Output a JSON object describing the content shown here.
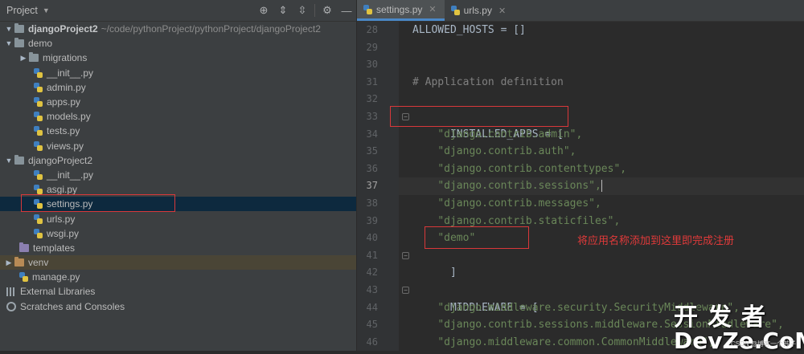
{
  "sidebar": {
    "title": "Project",
    "root": {
      "name": "djangoProject2",
      "path": "~/code/pythonProject/pythonProject/djangoProject2"
    },
    "items": [
      {
        "label": "demo"
      },
      {
        "label": "migrations"
      },
      {
        "label": "__init__.py"
      },
      {
        "label": "admin.py"
      },
      {
        "label": "apps.py"
      },
      {
        "label": "models.py"
      },
      {
        "label": "tests.py"
      },
      {
        "label": "views.py"
      },
      {
        "label": "djangoProject2"
      },
      {
        "label": "__init__.py"
      },
      {
        "label": "asgi.py"
      },
      {
        "label": "settings.py"
      },
      {
        "label": "urls.py"
      },
      {
        "label": "wsgi.py"
      },
      {
        "label": "templates"
      },
      {
        "label": "venv"
      },
      {
        "label": "manage.py"
      },
      {
        "label": "External Libraries"
      },
      {
        "label": "Scratches and Consoles"
      }
    ]
  },
  "tabs": [
    {
      "label": "settings.py",
      "active": true
    },
    {
      "label": "urls.py",
      "active": false
    }
  ],
  "editor": {
    "current_line": 37,
    "lines": [
      {
        "num": "28",
        "text": "ALLOWED_HOSTS = []"
      },
      {
        "num": "29",
        "text": ""
      },
      {
        "num": "30",
        "text": ""
      },
      {
        "num": "31",
        "text": "# Application definition"
      },
      {
        "num": "32",
        "text": ""
      },
      {
        "num": "33",
        "text": "INSTALLED_APPS = ["
      },
      {
        "num": "34",
        "text": "\"django.contrib.admin\","
      },
      {
        "num": "35",
        "text": "\"django.contrib.auth\","
      },
      {
        "num": "36",
        "text": "\"django.contrib.contenttypes\","
      },
      {
        "num": "37",
        "text": "\"django.contrib.sessions\","
      },
      {
        "num": "38",
        "text": "\"django.contrib.messages\","
      },
      {
        "num": "39",
        "text": "\"django.contrib.staticfiles\","
      },
      {
        "num": "40",
        "text": "\"demo\""
      },
      {
        "num": "41",
        "text": "]"
      },
      {
        "num": "42",
        "text": ""
      },
      {
        "num": "43",
        "text": "MIDDLEWARE = ["
      },
      {
        "num": "44",
        "text": "\"django.middleware.security.SecurityMiddleware\","
      },
      {
        "num": "45",
        "text": "\"django.contrib.sessions.middleware.SessionMiddleware\","
      },
      {
        "num": "46",
        "text": "\"django.middleware.common.CommonMiddleware\","
      }
    ]
  },
  "annotation": "将应用名称添加到这里即完成注册",
  "watermark": {
    "top": "开发者",
    "bottom": "DevZe.CoM",
    "sub": "CSDN @博客一个苏子"
  },
  "colors": {
    "highlight_box": "#d9383a",
    "selection": "#0d293e",
    "string": "#6a8759",
    "comment": "#808080"
  }
}
